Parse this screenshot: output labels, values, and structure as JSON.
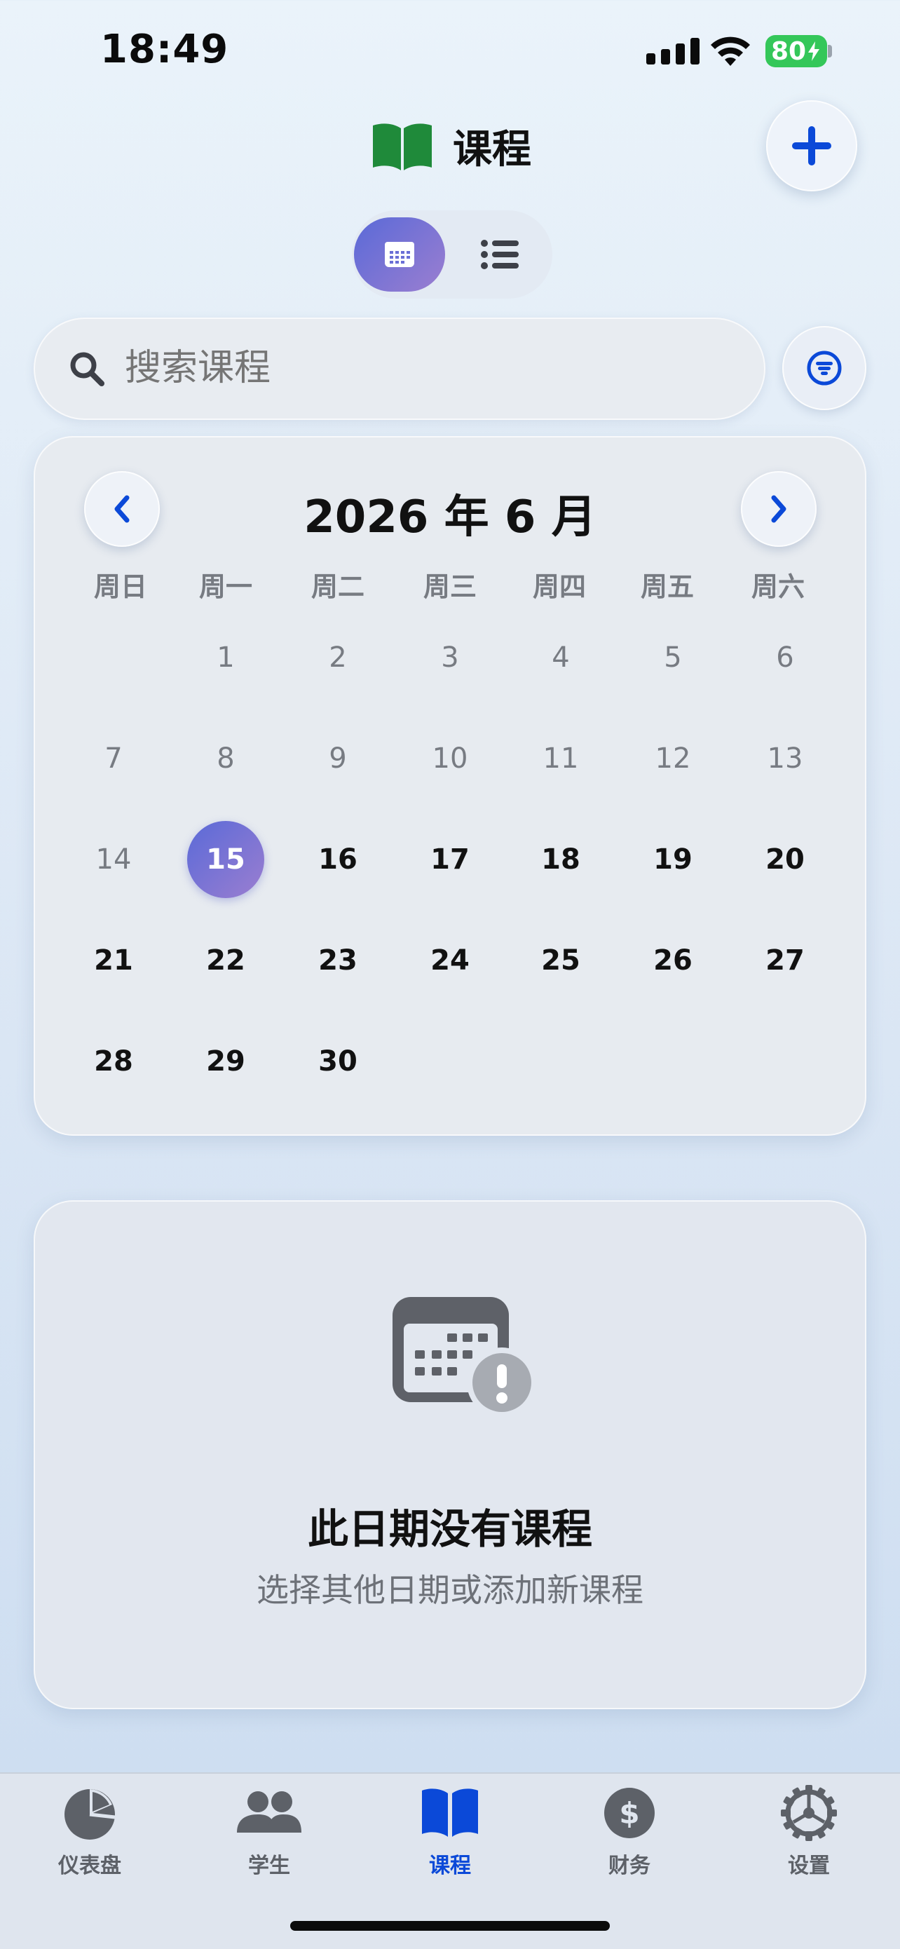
{
  "status_bar": {
    "time": "18:49",
    "battery": "80"
  },
  "header": {
    "title": "课程"
  },
  "search": {
    "placeholder": "搜索课程"
  },
  "calendar": {
    "month_title": "2026 年 6 月",
    "weekdays": [
      "周日",
      "周一",
      "周二",
      "周三",
      "周四",
      "周五",
      "周六"
    ],
    "weeks": [
      [
        "",
        "1",
        "2",
        "3",
        "4",
        "5",
        "6"
      ],
      [
        "7",
        "8",
        "9",
        "10",
        "11",
        "12",
        "13"
      ],
      [
        "14",
        "15",
        "16",
        "17",
        "18",
        "19",
        "20"
      ],
      [
        "21",
        "22",
        "23",
        "24",
        "25",
        "26",
        "27"
      ],
      [
        "28",
        "29",
        "30",
        "",
        "",
        "",
        ""
      ]
    ],
    "selected_day": "15"
  },
  "empty_state": {
    "title": "此日期没有课程",
    "subtitle": "选择其他日期或添加新课程"
  },
  "tabs": [
    {
      "label": "仪表盘",
      "icon": "pie-chart-icon"
    },
    {
      "label": "学生",
      "icon": "people-icon"
    },
    {
      "label": "课程",
      "icon": "book-icon",
      "active": true
    },
    {
      "label": "财务",
      "icon": "dollar-icon"
    },
    {
      "label": "设置",
      "icon": "gear-icon"
    }
  ],
  "colors": {
    "accent": "#0b49d8",
    "selected_gradient_start": "#5a6ad8",
    "selected_gradient_end": "#9b7ed0",
    "book_green": "#1f8a3a",
    "battery": "#34c759"
  }
}
